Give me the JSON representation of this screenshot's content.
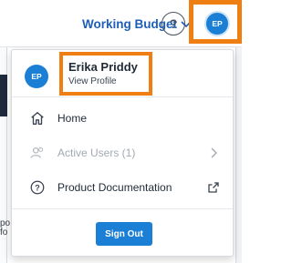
{
  "header": {
    "budget_label": "Working Budget",
    "help_label": "?",
    "avatar_initials": "EP"
  },
  "background": {
    "snippet_1": "po",
    "snippet_2": "fo"
  },
  "profile": {
    "initials": "EP",
    "name": "Erika Priddy",
    "link": "View Profile"
  },
  "menu": {
    "items": [
      {
        "label": "Home",
        "icon": "home-icon",
        "enabled": true
      },
      {
        "label": "Active Users (1)",
        "icon": "users-icon",
        "enabled": false,
        "trailing_icon": "chevron-right-icon"
      },
      {
        "label": "Product Documentation",
        "icon": "help-circle-icon",
        "enabled": true,
        "trailing_icon": "external-link-icon"
      }
    ],
    "signout_label": "Sign Out"
  },
  "colors": {
    "accent": "#1b7fd6",
    "highlight": "#f07f13",
    "link": "#1d5fb8",
    "disabled": "#a3a9b2"
  }
}
